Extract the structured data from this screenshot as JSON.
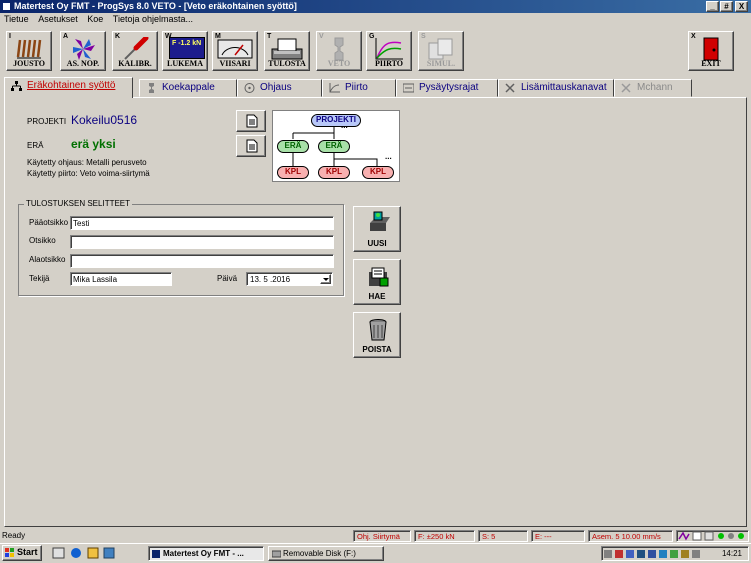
{
  "window": {
    "title": "Matertest Oy   FMT - ProgSys 8.0 VETO - [Veto eräkohtainen syöttö]"
  },
  "window_buttons": [
    "_",
    "#",
    "X"
  ],
  "menu": [
    "Tietue",
    "Asetukset",
    "Koe",
    "Tietoja ohjelmasta..."
  ],
  "toolbar": [
    {
      "key": "I",
      "label": "JOUSTO",
      "icon": "spring-icon",
      "enabled": true
    },
    {
      "key": "A",
      "label": "AS. NOP.",
      "icon": "fan-icon",
      "enabled": true
    },
    {
      "key": "K",
      "label": "KALIBR.",
      "icon": "screwdriver-icon",
      "enabled": true
    },
    {
      "key": "W",
      "label": "LUKEMA",
      "icon": "display-icon",
      "enabled": true,
      "display_text": "F -1.2 kN"
    },
    {
      "key": "M",
      "label": "VIISARI",
      "icon": "gauge-icon",
      "enabled": true
    },
    {
      "key": "T",
      "label": "TULOSTA",
      "icon": "printer-icon",
      "enabled": true
    },
    {
      "key": "V",
      "label": "VETO",
      "icon": "specimen-icon",
      "enabled": false
    },
    {
      "key": "G",
      "label": "PIIRTO",
      "icon": "graph-icon",
      "enabled": true
    },
    {
      "key": "S",
      "label": "SIMUL.",
      "icon": "simulation-icon",
      "enabled": false
    }
  ],
  "exit": {
    "key": "X",
    "label": "EXIT"
  },
  "tabs": [
    {
      "label": "Eräkohtainen syöttö",
      "active": true,
      "icon": "hierarchy-icon"
    },
    {
      "label": "Koekappale",
      "icon": "specimen-icon"
    },
    {
      "label": "Ohjaus",
      "icon": "steering-wheel-icon"
    },
    {
      "label": "Piirto",
      "icon": "graph-icon"
    },
    {
      "label": "Pysäytysrajat",
      "icon": "limits-icon"
    },
    {
      "label": "Lisämittauskanavat",
      "icon": "tools-icon"
    },
    {
      "label": "Mchann",
      "icon": "tools-icon",
      "disabled": true
    }
  ],
  "projekti": {
    "label": "PROJEKTI",
    "value": "Kokeilu0516"
  },
  "era": {
    "label": "ERÄ",
    "value": "erä yksi"
  },
  "used_control": "Käytetty ohjaus: Metalli perusveto",
  "used_plot": "Käytetty piirto: Veto voima-siirtymä",
  "diagram": {
    "root": "PROJEKTI",
    "batch": "ERÄ",
    "piece": "KPL",
    "ellipsis": "..."
  },
  "tulostus": {
    "title": "TULOSTUKSEN SELITTEET",
    "paaotsikko_label": "Pääotsikko",
    "paaotsikko": "Testi",
    "otsikko_label": "Otsikko",
    "otsikko": "",
    "alaotsikko_label": "Alaotsikko",
    "alaotsikko": "",
    "tekija_label": "Tekijä",
    "tekija": "Mika Lassila",
    "paiva_label": "Päivä",
    "paiva": "13. 5 .2016"
  },
  "actions": {
    "new": "UUSI",
    "fetch": "HAE",
    "delete": "POISTA"
  },
  "status": {
    "ready": "Ready",
    "control": "Ohj. Siirtymä",
    "force": "F: ±250 kN",
    "s": "S: 5",
    "e": "E: ---",
    "asem": "Asem. 5 10.00 mm/s"
  },
  "taskbar": {
    "start": "Start",
    "task1": "Matertest Oy   FMT - ...",
    "task2": "Removable Disk (F:)",
    "clock": "14:21"
  },
  "colors": {
    "title_start": "#0a246a",
    "title_end": "#3a6ea5",
    "navy_text": "#0a0080",
    "green_text": "#007000",
    "status_red": "#c00000"
  }
}
